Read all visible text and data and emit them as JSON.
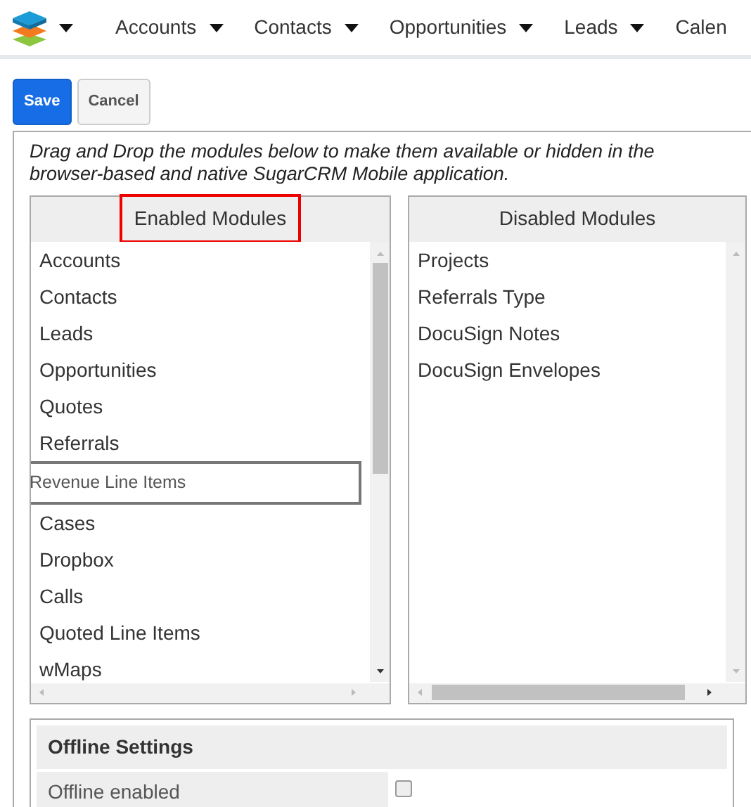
{
  "nav": {
    "items": [
      {
        "label": "Accounts"
      },
      {
        "label": "Contacts"
      },
      {
        "label": "Opportunities"
      },
      {
        "label": "Leads"
      },
      {
        "label": "Calen"
      }
    ]
  },
  "buttons": [
    {
      "label": "Save",
      "kind": "primary"
    },
    {
      "label": "Cancel",
      "kind": "secondary"
    }
  ],
  "instructions": "Drag and Drop the modules below to make them available or hidden in the browser-based and native SugarCRM Mobile application.",
  "columns": [
    {
      "title": "Enabled Modules",
      "highlighted": true,
      "items": [
        {
          "label": "Accounts",
          "dragging": false
        },
        {
          "label": "Contacts",
          "dragging": false
        },
        {
          "label": "Leads",
          "dragging": false
        },
        {
          "label": "Opportunities",
          "dragging": false
        },
        {
          "label": "Quotes",
          "dragging": false
        },
        {
          "label": "Referrals",
          "dragging": false
        },
        {
          "label": "Revenue Line Items",
          "dragging": true
        },
        {
          "label": "Cases",
          "dragging": false
        },
        {
          "label": "Dropbox",
          "dragging": false
        },
        {
          "label": "Calls",
          "dragging": false
        },
        {
          "label": "Quoted Line Items",
          "dragging": false
        },
        {
          "label": "wMaps",
          "dragging": false
        }
      ]
    },
    {
      "title": "Disabled Modules",
      "highlighted": false,
      "items": [
        {
          "label": "Projects",
          "dragging": false
        },
        {
          "label": "Referrals Type",
          "dragging": false
        },
        {
          "label": "DocuSign Notes",
          "dragging": false
        },
        {
          "label": "DocuSign Envelopes",
          "dragging": false
        }
      ]
    }
  ],
  "offline_settings": {
    "title": "Offline Settings",
    "rows": [
      {
        "label": "Offline enabled",
        "checked": false
      }
    ]
  }
}
